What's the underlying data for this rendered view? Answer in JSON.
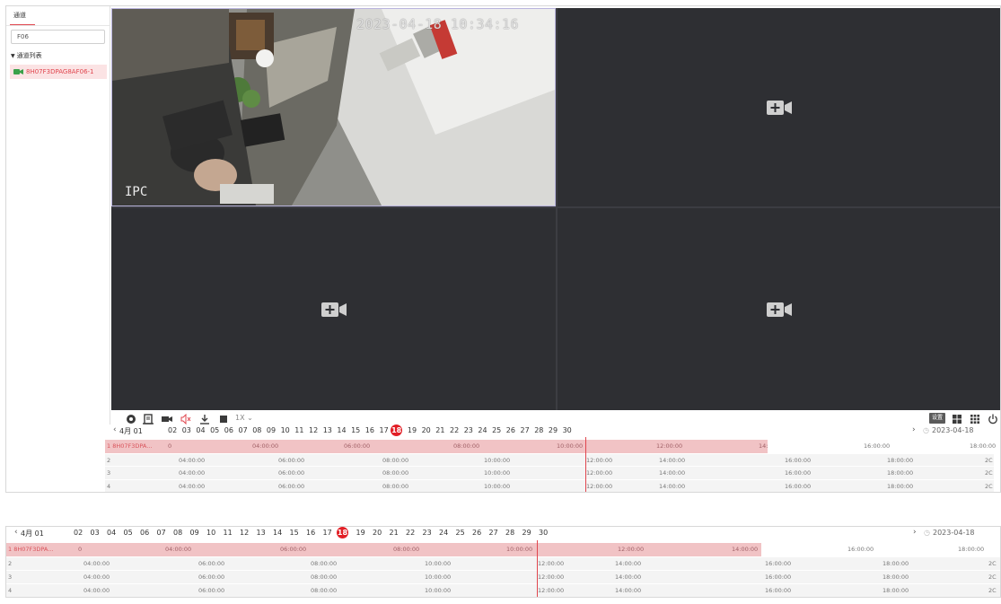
{
  "sidebar": {
    "tab_label": "通道",
    "search_value": "F06",
    "tree_header": "通道列表",
    "channel_label": "8H07F3DPAG8AF06-1"
  },
  "video": {
    "osd_time": "2023-04-18 10:34:16",
    "osd_name": "IPC"
  },
  "toolbar": {
    "speed_label": "1X",
    "settings_label": "设置",
    "icons": [
      "record-dot-icon",
      "screenshot-icon",
      "camera-icon",
      "mute-icon",
      "download-icon",
      "stop-icon",
      "speed-dropdown-icon",
      "quad-layout-icon",
      "grid-layout-icon",
      "power-icon"
    ]
  },
  "timeline": {
    "month_label": "4月 01",
    "days": [
      "02",
      "03",
      "04",
      "05",
      "06",
      "07",
      "08",
      "09",
      "10",
      "11",
      "12",
      "13",
      "14",
      "15",
      "16",
      "17",
      "18",
      "19",
      "20",
      "21",
      "22",
      "23",
      "24",
      "25",
      "26",
      "27",
      "28",
      "29",
      "30"
    ],
    "today": "18",
    "date": "2023-04-18",
    "row1": {
      "label": "1 8H07F3DPA...",
      "start": "0",
      "times": [
        "04:00:00",
        "06:00:00",
        "08:00:00",
        "10:00:00",
        "12:00:00",
        "14:00:00",
        "16:00:00",
        "18:00:00"
      ]
    },
    "rows": [
      {
        "label": "2",
        "times": [
          "04:00:00",
          "06:00:00",
          "08:00:00",
          "10:00:00",
          "12:00:00",
          "14:00:00",
          "16:00:00",
          "18:00:00",
          "2C"
        ]
      },
      {
        "label": "3",
        "times": [
          "04:00:00",
          "06:00:00",
          "08:00:00",
          "10:00:00",
          "12:00:00",
          "14:00:00",
          "16:00:00",
          "18:00:00",
          "2C"
        ]
      },
      {
        "label": "4",
        "times": [
          "04:00:00",
          "06:00:00",
          "08:00:00",
          "10:00:00",
          "12:00:00",
          "14:00:00",
          "16:00:00",
          "18:00:00",
          "2C"
        ]
      }
    ]
  },
  "colors": {
    "accent": "#e0464e",
    "video_bg": "#2e2f33",
    "record_band": "#f1c3c5"
  }
}
